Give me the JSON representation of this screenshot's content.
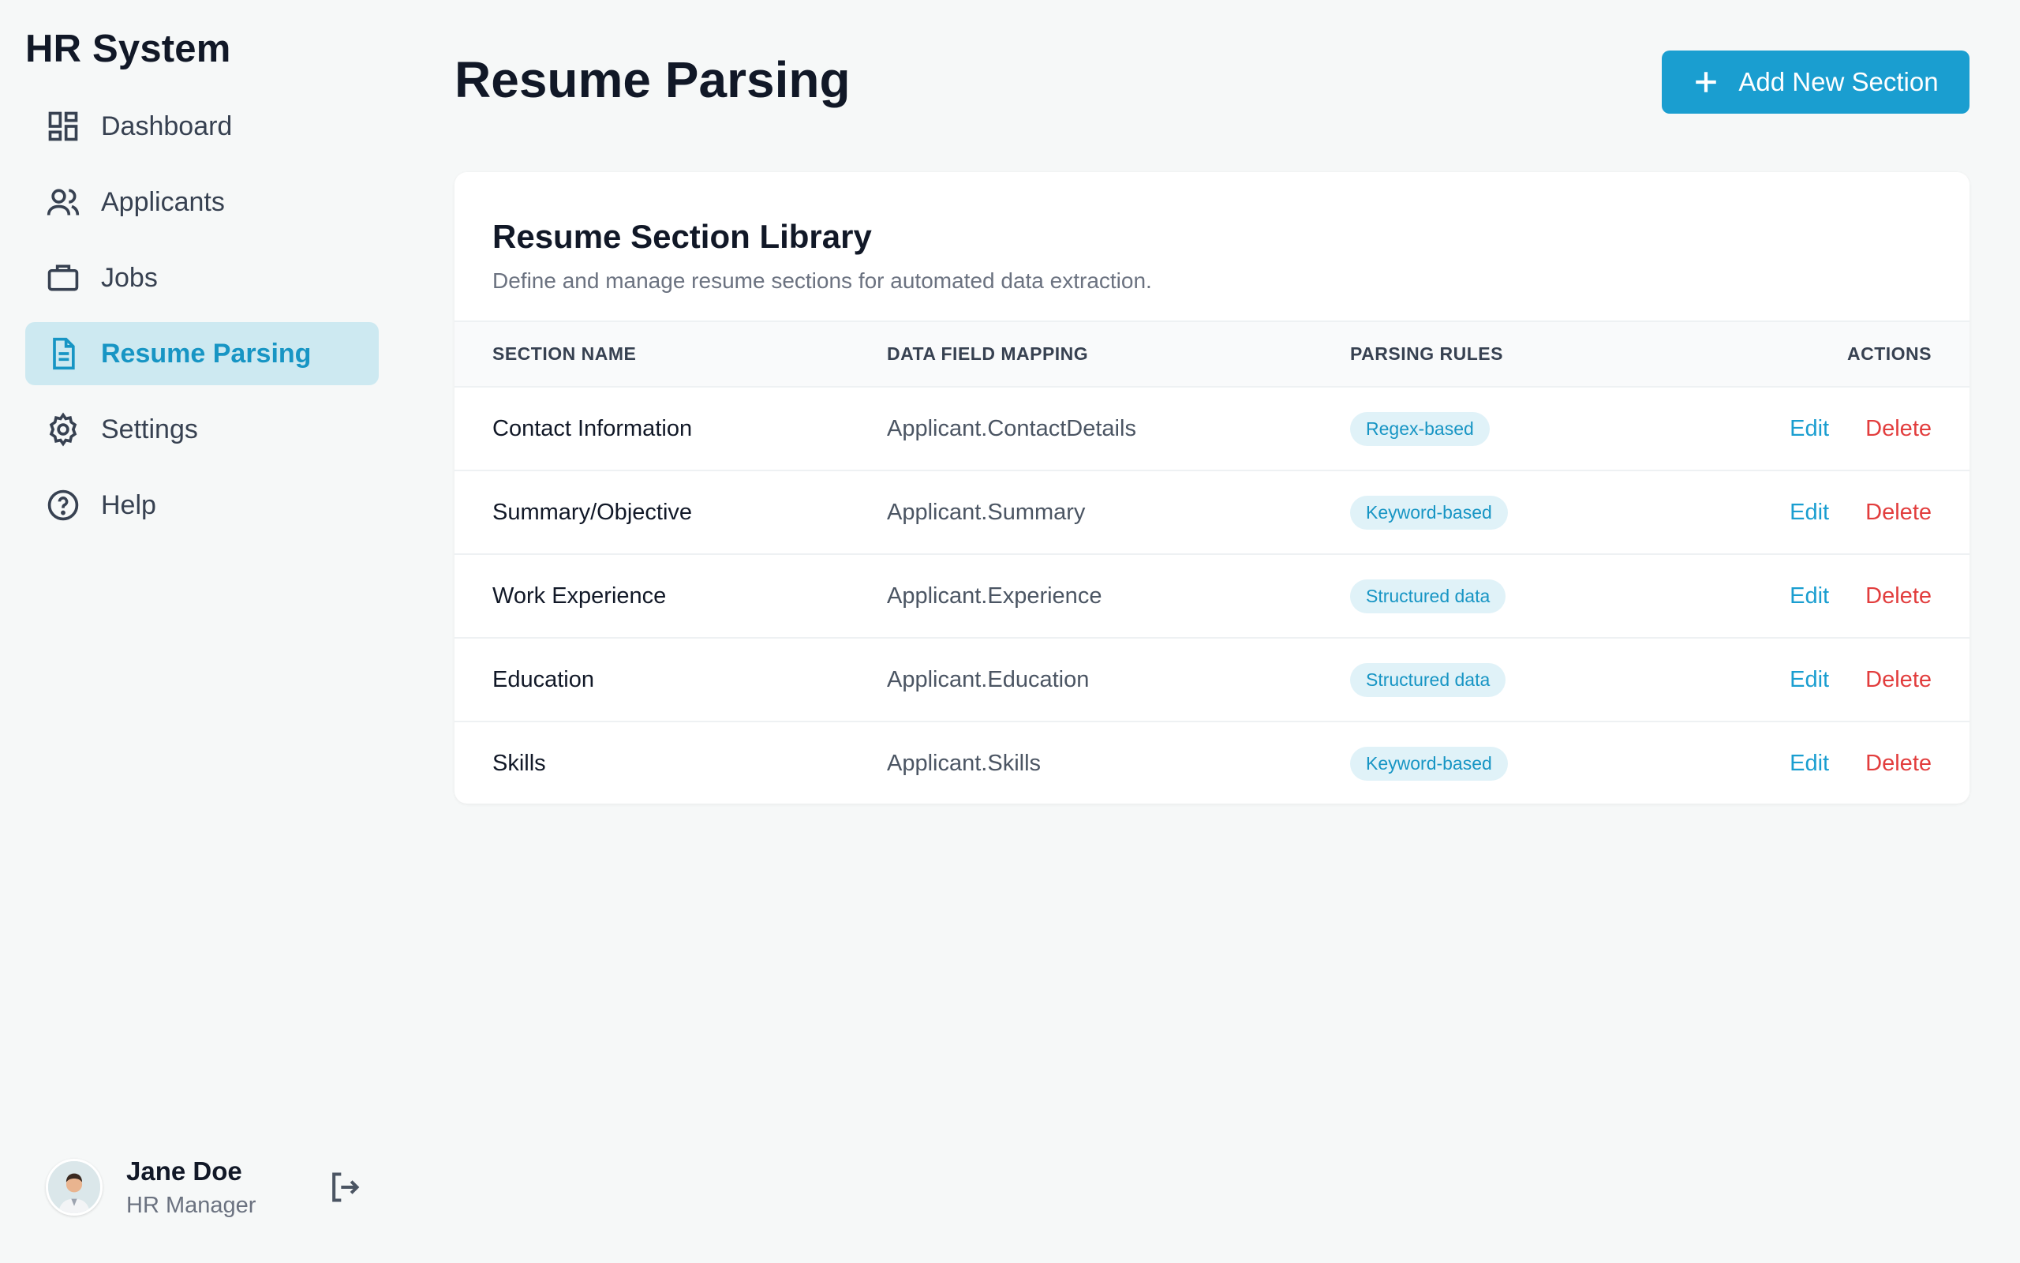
{
  "app": {
    "brand": "HR System"
  },
  "sidebar": {
    "items": [
      {
        "label": "Dashboard",
        "icon": "dashboard-icon",
        "active": false
      },
      {
        "label": "Applicants",
        "icon": "users-icon",
        "active": false
      },
      {
        "label": "Jobs",
        "icon": "briefcase-icon",
        "active": false
      },
      {
        "label": "Resume Parsing",
        "icon": "document-icon",
        "active": true
      },
      {
        "label": "Settings",
        "icon": "gear-icon",
        "active": false
      },
      {
        "label": "Help",
        "icon": "help-icon",
        "active": false
      }
    ]
  },
  "user": {
    "name": "Jane Doe",
    "role": "HR Manager"
  },
  "header": {
    "title": "Resume Parsing",
    "add_button": "Add New Section"
  },
  "library": {
    "title": "Resume Section Library",
    "description": "Define and manage resume sections for automated data extraction.",
    "columns": [
      "SECTION NAME",
      "DATA FIELD MAPPING",
      "PARSING RULES",
      "ACTIONS"
    ],
    "rows": [
      {
        "name": "Contact Information",
        "mapping": "Applicant.ContactDetails",
        "rule": "Regex-based",
        "edit": "Edit",
        "delete": "Delete"
      },
      {
        "name": "Summary/Objective",
        "mapping": "Applicant.Summary",
        "rule": "Keyword-based",
        "edit": "Edit",
        "delete": "Delete"
      },
      {
        "name": "Work Experience",
        "mapping": "Applicant.Experience",
        "rule": "Structured data",
        "edit": "Edit",
        "delete": "Delete"
      },
      {
        "name": "Education",
        "mapping": "Applicant.Education",
        "rule": "Structured data",
        "edit": "Edit",
        "delete": "Delete"
      },
      {
        "name": "Skills",
        "mapping": "Applicant.Skills",
        "rule": "Keyword-based",
        "edit": "Edit",
        "delete": "Delete"
      }
    ]
  },
  "colors": {
    "accent": "#1a9ed0",
    "active_bg": "#cde9f1",
    "danger": "#e23d3d",
    "background": "#f6f8f8"
  }
}
